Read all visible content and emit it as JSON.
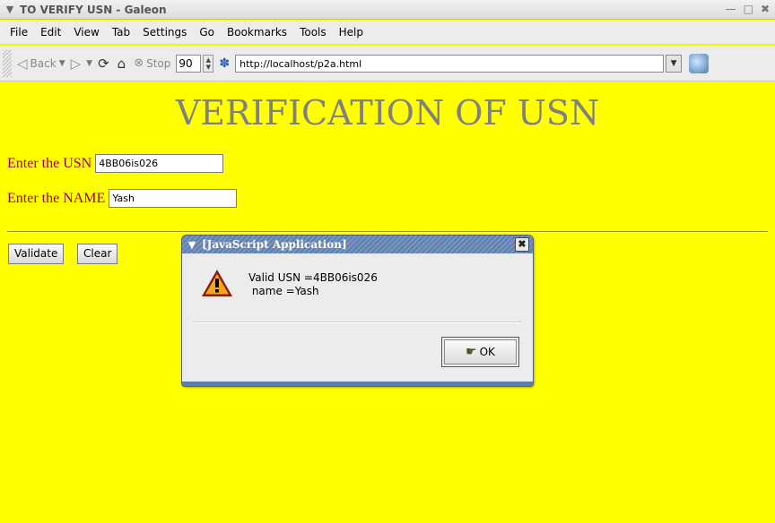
{
  "window": {
    "title": "TO VERIFY USN - Galeon"
  },
  "menu": [
    "File",
    "Edit",
    "View",
    "Tab",
    "Settings",
    "Go",
    "Bookmarks",
    "Tools",
    "Help"
  ],
  "toolbar": {
    "back_label": "Back",
    "stop_label": "Stop",
    "zoom_value": "90",
    "url": "http://localhost/p2a.html"
  },
  "page": {
    "heading": "VERIFICATION OF USN",
    "usn_label": "Enter the USN",
    "usn_value": "4BB06is026",
    "name_label": "Enter the NAME",
    "name_value": "Yash",
    "validate_label": "Validate",
    "clear_label": "Clear",
    "background_color": "#ffff00"
  },
  "dialog": {
    "title": "[JavaScript Application]",
    "message_line1": "Valid USN =4BB06is026",
    "message_line2": " name =Yash",
    "ok_label": "OK"
  }
}
